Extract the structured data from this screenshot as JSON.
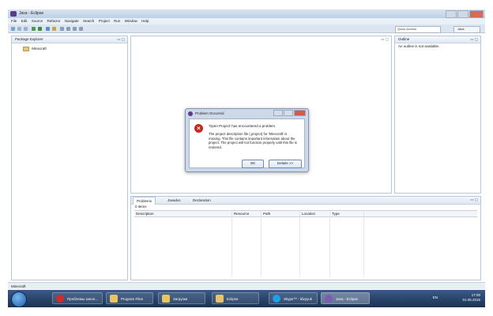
{
  "window": {
    "title": "Java - Eclipse"
  },
  "menu": [
    "File",
    "Edit",
    "Source",
    "Refactor",
    "Navigate",
    "Search",
    "Project",
    "Run",
    "Window",
    "Help"
  ],
  "toolbar": {
    "quick_access_placeholder": "Quick Access",
    "perspective": "Java"
  },
  "package_explorer": {
    "title": "Package Explorer",
    "items": [
      "Minecraft"
    ]
  },
  "outline": {
    "title": "Outline",
    "message": "An outline is not available."
  },
  "bottom_panel": {
    "tabs": [
      "Problems",
      "Javadoc",
      "Declaration"
    ],
    "items_count": "0 items",
    "columns": [
      "Description",
      "Resource",
      "Path",
      "Location",
      "Type"
    ]
  },
  "status": {
    "text": "Minecraft"
  },
  "dialog": {
    "title": "Problem Occurred",
    "heading": "'Open Project' has encountered a problem.",
    "message": "The project description file (.project) for 'Minecraft' is missing.  This file contains important information about the project.  The project will not function properly until this file is restored.",
    "ok_label": "OK",
    "details_label": "Details >>"
  },
  "taskbar": {
    "items": [
      "Проблемы запол...",
      "Program Files",
      "Загрузки",
      "Eclipse",
      "Skype™ - ldvyyuk",
      "Java - Eclipse"
    ],
    "lang": "EN",
    "time": "17:00",
    "date": "01.06.2015"
  },
  "colors": {
    "accent": "#3a5a86",
    "error": "#c9271e"
  },
  "icons": [
    "eclipse-icon",
    "error-icon",
    "folder-icon",
    "start-orb-icon"
  ]
}
